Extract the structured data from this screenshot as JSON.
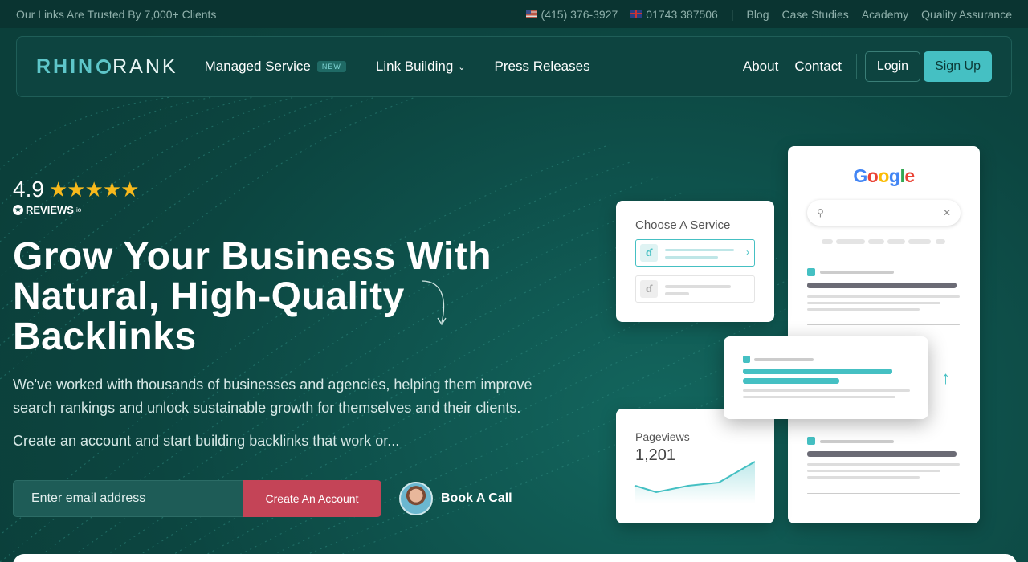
{
  "topbar": {
    "trust_text": "Our Links Are Trusted By 7,000+ Clients",
    "phone_us": "(415) 376-3927",
    "phone_uk": "01743 387506",
    "links": [
      "Blog",
      "Case Studies",
      "Academy",
      "Quality Assurance"
    ]
  },
  "nav": {
    "logo_rhino": "RHIN",
    "logo_rank": "RANK",
    "managed_service": "Managed Service",
    "new_badge": "NEW",
    "link_building": "Link Building",
    "press_releases": "Press Releases",
    "about": "About",
    "contact": "Contact",
    "login": "Login",
    "signup": "Sign Up"
  },
  "hero": {
    "rating_value": "4.9",
    "stars": "★★★★★",
    "reviews_brand": "REVIEWS",
    "reviews_suffix": "io",
    "headline": "Grow Your Business With Natural, High-Quality Backlinks",
    "subtext": "We've worked with thousands of businesses and agencies, helping them improve search rankings and unlock sustainable growth for themselves and their clients.",
    "cta_text": "Create an account and start building backlinks that work or...",
    "email_placeholder": "Enter email address",
    "create_button": "Create An Account",
    "book_call": "Book A Call"
  },
  "mockup": {
    "google_logo": [
      "G",
      "o",
      "o",
      "g",
      "l",
      "e"
    ],
    "service_title": "Choose A Service",
    "pageviews_label": "Pageviews",
    "pageviews_value": "1,201"
  },
  "colors": {
    "accent": "#45c0c3",
    "cta": "#c44457",
    "background": "#0d4a45",
    "star": "#f8b91c"
  }
}
